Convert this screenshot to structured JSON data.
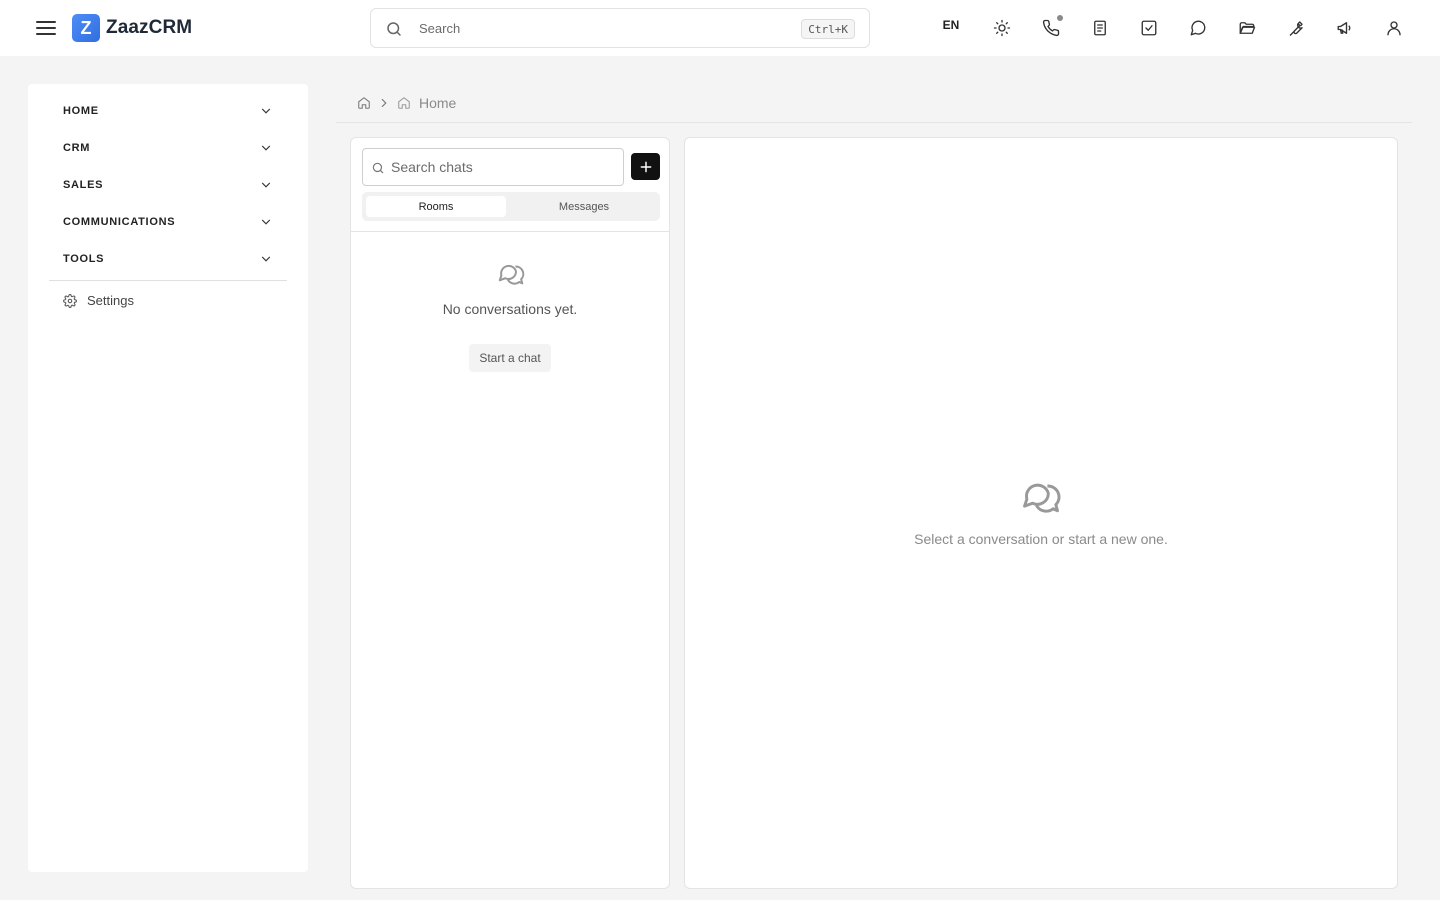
{
  "header": {
    "logo_letter": "Z",
    "app_name": "ZaazCRM",
    "search_placeholder": "Search",
    "search_shortcut": "Ctrl+K",
    "language": "EN",
    "icons": [
      "menu-icon",
      "sun-icon",
      "phone-icon",
      "notes-icon",
      "tasks-icon",
      "chat-icon",
      "folder-icon",
      "wrench-icon",
      "megaphone-icon",
      "user-icon"
    ]
  },
  "sidebar": {
    "items": [
      {
        "label": "HOME"
      },
      {
        "label": "CRM"
      },
      {
        "label": "SALES"
      },
      {
        "label": "COMMUNICATIONS"
      },
      {
        "label": "TOOLS"
      }
    ],
    "settings_label": "Settings"
  },
  "breadcrumb": {
    "current": "Home"
  },
  "chats": {
    "search_placeholder": "Search chats",
    "tabs": [
      {
        "label": "Rooms",
        "active": true
      },
      {
        "label": "Messages",
        "active": false
      }
    ],
    "empty_text": "No conversations yet.",
    "start_label": "Start a chat"
  },
  "conversation": {
    "empty_text": "Select a conversation or start a new one."
  },
  "colors": {
    "accent": "#2f6ee0",
    "background": "#f4f4f4",
    "primary_button": "#111111"
  }
}
